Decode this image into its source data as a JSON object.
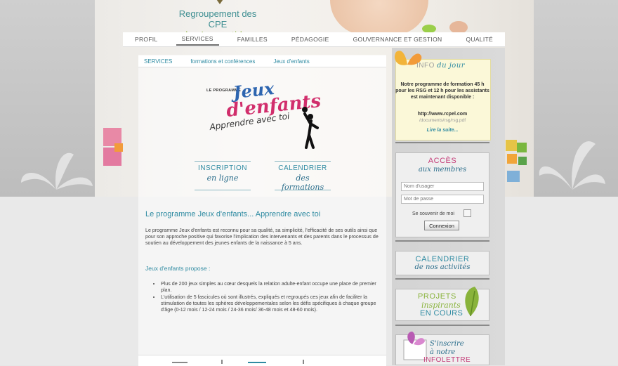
{
  "site": {
    "logo_line1": "Regroupement des CPE",
    "logo_line2": "des Laurentides"
  },
  "nav": {
    "items": [
      "PROFIL",
      "SERVICES",
      "FAMILLES",
      "PÉDAGOGIE",
      "GOUVERNANCE ET GESTION",
      "QUALITÉ"
    ],
    "active": "SERVICES"
  },
  "breadcrumb": [
    "SERVICES",
    "formations et conférences",
    "Jeux d'enfants"
  ],
  "program_logo": {
    "prefix": "LE PROGRAMME",
    "line1": "Jeux",
    "line2": "d'enfants",
    "line3": "Apprendre avec toi"
  },
  "cta": {
    "inscription": {
      "a": "INSCRIPTION",
      "b": "en ligne"
    },
    "calendrier": {
      "a": "CALENDRIER",
      "b": "des formations"
    }
  },
  "article": {
    "title": "Le programme Jeux d'enfants... Apprendre avec toi",
    "paragraph": "Le programme Jeux d'enfants est reconnu pour sa qualité, sa simplicité, l'efficacité de ses outils ainsi que pour son approche positive qui favorise l'implication des intervenants et des parents dans le processus de soutien au développement des jeunes enfants de la naissance à 5 ans.",
    "subtitle": "Jeux d'enfants propose :",
    "bullets": [
      "Plus de 200 jeux simples au cœur desquels la relation adulte-enfant occupe une place de premier plan.",
      "L'utilisation de 5 fascicules où sont illustrés, expliqués et regroupés ces jeux afin de faciliter la stimulation de toutes les sphères développementales selon les défis spécifiques à chaque groupe d'âge (0-12 mois / 12-24 mois / 24-36 mois/ 36-48 mois et 48-60 mois)."
    ]
  },
  "info": {
    "title_a": "INFO",
    "title_b": "du jour",
    "text": "Notre programme de formation 45 h pour les RSG et 12 h  pour les assistants est maintenant disponible :",
    "url": "http://www.rcpel.com",
    "url2": "/documents/rsg/rsg.pdf",
    "more": "Lire la suite..."
  },
  "login": {
    "title": "ACCÈS",
    "subtitle": "aux membres",
    "username_placeholder": "Nom d'usager",
    "password_placeholder": "Mot de passe",
    "remember": "Se souvenir de moi",
    "submit": "Connexion"
  },
  "sidebar_calendar": {
    "a": "CALENDRIER",
    "b": "de nos activités"
  },
  "projects": {
    "a": "PROJETS",
    "b": "inspirants",
    "c": "EN COURS"
  },
  "newsletter": {
    "a": "S'inscrire",
    "b": "à notre",
    "c": "INFOLETTRE"
  },
  "colors": {
    "accent_teal": "#2f8ba2",
    "accent_pink": "#c43c78",
    "accent_green": "#89b33b",
    "info_bg": "#fbf8d8"
  }
}
